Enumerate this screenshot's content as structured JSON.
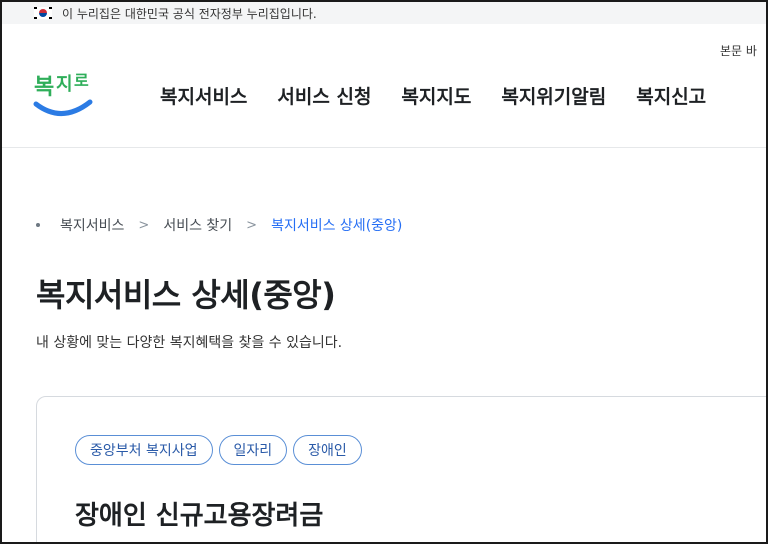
{
  "gov_banner": {
    "text": "이 누리집은 대한민국 공식 전자정부 누리집입니다."
  },
  "header": {
    "skip_link": "본문 바",
    "logo_text": "복지로",
    "nav": [
      "복지서비스",
      "서비스 신청",
      "복지지도",
      "복지위기알림",
      "복지신고"
    ]
  },
  "breadcrumb": {
    "items": [
      "복지서비스",
      "서비스 찾기"
    ],
    "current": "복지서비스 상세(중앙)"
  },
  "page": {
    "title": "복지서비스 상세(중앙)",
    "description": "내 상황에 맞는 다양한 복지혜택을 찾을 수 있습니다."
  },
  "card": {
    "tags": [
      "중앙부처 복지사업",
      "일자리",
      "장애인"
    ],
    "title": "장애인 신규고용장려금"
  },
  "colors": {
    "brand_blue": "#256ef4",
    "logo_green": "#2fae5a",
    "tag_border": "#5a8fd6"
  }
}
